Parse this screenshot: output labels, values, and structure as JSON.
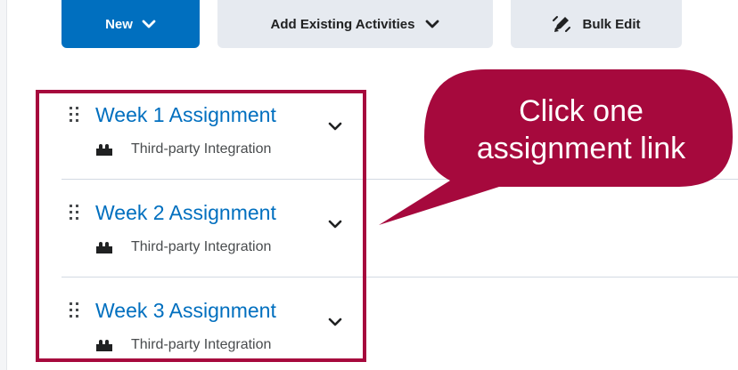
{
  "toolbar": {
    "new_label": "New",
    "add_existing_label": "Add Existing Activities",
    "bulk_edit_label": "Bulk Edit"
  },
  "items": [
    {
      "title": "Week 1 Assignment",
      "type": "Third-party Integration"
    },
    {
      "title": "Week 2 Assignment",
      "type": "Third-party Integration"
    },
    {
      "title": "Week 3 Assignment",
      "type": "Third-party Integration"
    }
  ],
  "callout": {
    "line1": "Click one",
    "line2": "assignment link"
  },
  "colors": {
    "primary": "#006fbf",
    "secondary_button": "#e6eaf0",
    "highlight": "#a6093d",
    "callout": "#a6093d"
  },
  "icons": {
    "new_button": "chevron-down-icon",
    "add_existing_button": "chevron-down-icon",
    "bulk_edit_button": "pencil-edit-icon",
    "drag": "drag-handle-icon",
    "type": "puzzle-icon",
    "row_action": "chevron-down-icon"
  }
}
